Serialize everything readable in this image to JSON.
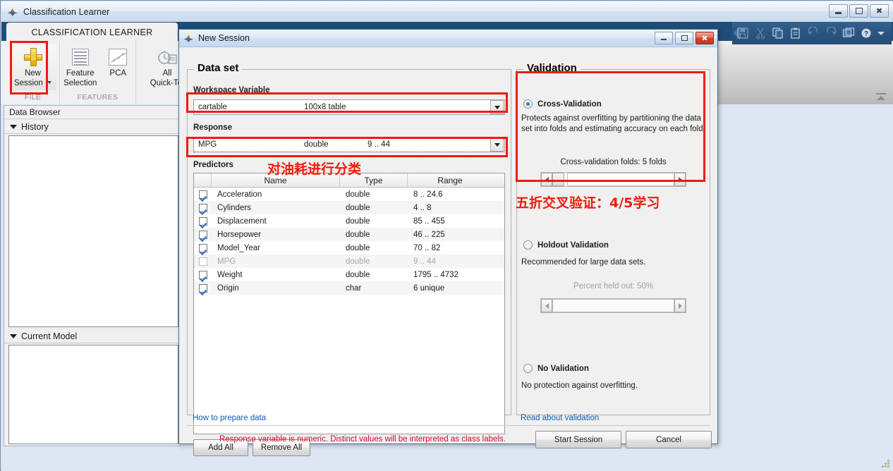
{
  "main_window": {
    "title": "Classification Learner",
    "logo_icon": "matlab-logo-icon",
    "min_label": "Minimize",
    "max_label": "Maximize",
    "close_label": "Close"
  },
  "ribbon": {
    "active_tab": "CLASSIFICATION LEARNER",
    "groups": [
      {
        "label": "FILE",
        "buttons": [
          {
            "name": "new-session",
            "label_line1": "New",
            "label_line2": "Session",
            "icon": "plus-icon",
            "has_dropdown": true
          }
        ]
      },
      {
        "label": "FEATURES",
        "buttons": [
          {
            "name": "feature-selection",
            "label_line1": "Feature",
            "label_line2": "Selection",
            "icon": "list-icon"
          },
          {
            "name": "pca",
            "label_line1": "PCA",
            "label_line2": "",
            "icon": "scatter-plot-icon"
          }
        ]
      },
      {
        "label": "",
        "buttons": [
          {
            "name": "all-quick-to-train",
            "label_line1": "All",
            "label_line2": "Quick-To.",
            "icon": "stopwatch-icon"
          }
        ]
      }
    ]
  },
  "quick_access": {
    "icons": [
      "save-icon",
      "cut-icon",
      "copy-icon",
      "paste-icon",
      "undo-icon",
      "redo-icon",
      "layout-icon",
      "help-icon",
      "chevron-down-icon"
    ]
  },
  "data_browser": {
    "title": "Data Browser",
    "panels": [
      {
        "name": "history",
        "label": "History"
      },
      {
        "name": "current-model",
        "label": "Current Model"
      }
    ]
  },
  "dialog": {
    "title": "New Session",
    "logo_icon": "matlab-logo-icon",
    "data_set": {
      "legend": "Data set",
      "workspace_variable": {
        "label": "Workspace Variable",
        "value_name": "cartable",
        "value_size": "100x8 table",
        "highlighted": true
      },
      "response": {
        "label": "Response",
        "value_name": "MPG",
        "value_type": "double",
        "value_range": "9 .. 44",
        "highlighted": true
      },
      "predictors": {
        "label": "Predictors",
        "columns": [
          "",
          "Name",
          "Type",
          "Range"
        ],
        "rows": [
          {
            "checked": true,
            "name": "Acceleration",
            "type": "double",
            "range": "8 .. 24.6",
            "enabled": true
          },
          {
            "checked": true,
            "name": "Cylinders",
            "type": "double",
            "range": "4 .. 8",
            "enabled": true
          },
          {
            "checked": true,
            "name": "Displacement",
            "type": "double",
            "range": "85 .. 455",
            "enabled": true
          },
          {
            "checked": true,
            "name": "Horsepower",
            "type": "double",
            "range": "46 .. 225",
            "enabled": true
          },
          {
            "checked": true,
            "name": "Model_Year",
            "type": "double",
            "range": "70 .. 82",
            "enabled": true
          },
          {
            "checked": false,
            "name": "MPG",
            "type": "double",
            "range": "9 .. 44",
            "enabled": false
          },
          {
            "checked": true,
            "name": "Weight",
            "type": "double",
            "range": "1795 .. 4732",
            "enabled": true
          },
          {
            "checked": true,
            "name": "Origin",
            "type": "char",
            "range": "6 unique",
            "enabled": true
          }
        ]
      },
      "add_all_label": "Add All",
      "remove_all_label": "Remove All",
      "help_link": "How to prepare data"
    },
    "validation": {
      "legend": "Validation",
      "cross_validation": {
        "label": "Cross-Validation",
        "selected": true,
        "highlighted": true,
        "description": "Protects against overfitting by partitioning the data set into folds and estimating accuracy on each fold.",
        "folds_label": "Cross-validation folds: 5 folds",
        "folds_value": 5
      },
      "holdout_validation": {
        "label": "Holdout Validation",
        "selected": false,
        "description": "Recommended for large data sets.",
        "percent_label": "Percent held out: 50%",
        "percent_value": 50
      },
      "no_validation": {
        "label": "No Validation",
        "selected": false,
        "description": "No protection against overfitting."
      },
      "help_link": "Read about validation"
    },
    "status_message": "Response variable is numeric. Distinct values will be interpreted as class labels.",
    "start_session_label": "Start Session",
    "cancel_label": "Cancel"
  },
  "annotations": [
    {
      "name": "annotation-classify-fuel-consumption",
      "text": "对油耗进行分类",
      "color": "#f21b0a"
    },
    {
      "name": "annotation-five-fold-cross-validation",
      "text": "五折交叉验证：4/5学习",
      "color": "#f21b0a"
    }
  ],
  "colors": {
    "highlight_red": "#ee1b11",
    "annotation_red": "#f21b0a",
    "status_red": "#c8102e",
    "link_blue": "#0b5fb5",
    "ribbon_blue": "#22527f",
    "accent_yellow": "#e0a800"
  }
}
